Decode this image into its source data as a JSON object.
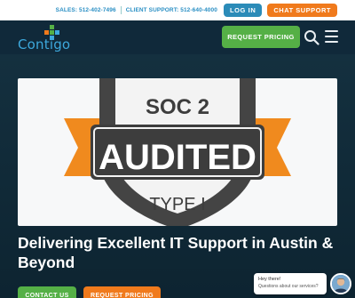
{
  "topbar": {
    "sales_label": "SALES:",
    "sales_phone": "512-402-7496",
    "support_label": "CLIENT SUPPORT:",
    "support_phone": "512-640-4000",
    "login_label": "LOG IN",
    "chat_label": "CHAT SUPPORT"
  },
  "header": {
    "logo_text": "Contigo",
    "request_pricing_label": "REQUEST PRICING"
  },
  "hero": {
    "badge": {
      "line1": "SOC 2",
      "line2": "AUDITED",
      "line3": "TYPE I"
    },
    "title": "Delivering Excellent IT Support in Austin & Beyond",
    "contact_label": "CONTACT US",
    "pricing_label": "REQUEST PRICING"
  },
  "chat_widget": {
    "greeting": "Hey there!",
    "prompt": "Questions about our services?"
  },
  "colors": {
    "brand_blue": "#2b8bb8",
    "brand_green": "#55b046",
    "brand_orange": "#f07a1c",
    "header_bg": "#10293a"
  }
}
